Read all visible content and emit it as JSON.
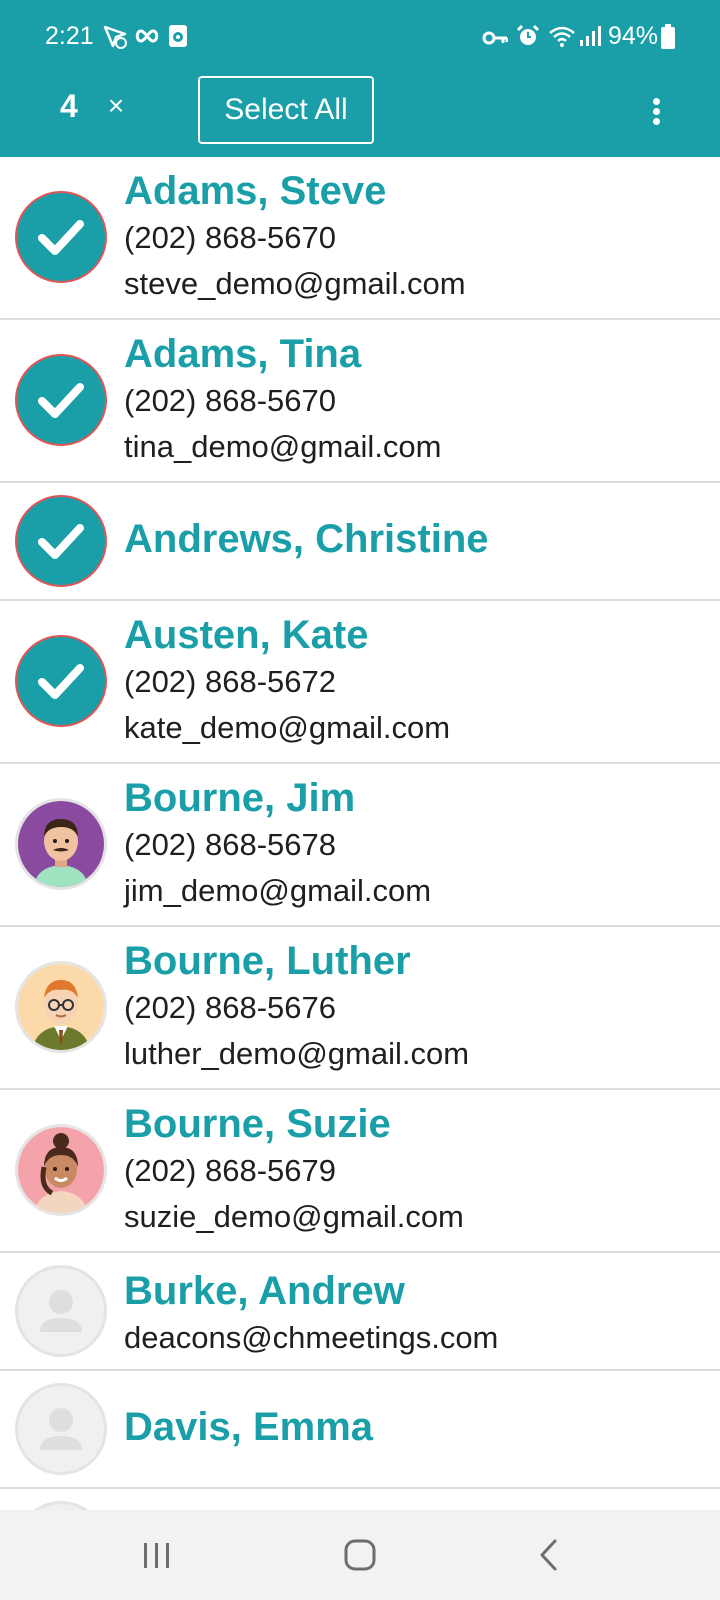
{
  "status_bar": {
    "time": "2:21",
    "battery": "94%",
    "left_icons": [
      "nav-arrow-icon",
      "infinity-icon",
      "app-badge-icon"
    ],
    "right_icons": [
      "key-icon",
      "alarm-icon",
      "wifi-icon",
      "signal-icon",
      "battery-icon"
    ]
  },
  "app_bar": {
    "selected_count": "4",
    "close_symbol": "×",
    "select_all_label": "Select All",
    "menu_icon": "more-vert-icon"
  },
  "colors": {
    "accent": "#1a9fa9",
    "check_border": "#e05656",
    "text": "#1f1f1f",
    "divider": "#dcdcdc"
  },
  "contacts": [
    {
      "name": "Adams, Steve",
      "phone": "(202) 868-5670",
      "email": "steve_demo@gmail.com",
      "selected": true,
      "avatar": "check-icon"
    },
    {
      "name": "Adams, Tina",
      "phone": "(202) 868-5670",
      "email": "tina_demo@gmail.com",
      "selected": true,
      "avatar": "check-icon"
    },
    {
      "name": "Andrews, Christine",
      "selected": true,
      "avatar": "check-icon"
    },
    {
      "name": "Austen, Kate",
      "phone": "(202) 868-5672",
      "email": "kate_demo@gmail.com",
      "selected": true,
      "avatar": "check-icon"
    },
    {
      "name": "Bourne, Jim",
      "phone": "(202) 868-5678",
      "email": "jim_demo@gmail.com",
      "selected": false,
      "avatar": "man-mustache-avatar"
    },
    {
      "name": "Bourne, Luther",
      "phone": "(202) 868-5676",
      "email": "luther_demo@gmail.com",
      "selected": false,
      "avatar": "man-glasses-avatar"
    },
    {
      "name": "Bourne, Suzie",
      "phone": "(202) 868-5679",
      "email": "suzie_demo@gmail.com",
      "selected": false,
      "avatar": "woman-avatar"
    },
    {
      "name": "Burke, Andrew",
      "email": "deacons@chmeetings.com",
      "selected": false,
      "avatar": "placeholder-avatar"
    },
    {
      "name": "Davis, Emma",
      "selected": false,
      "avatar": "placeholder-avatar"
    }
  ],
  "nav_bar": {
    "icons": [
      "recent-apps-icon",
      "home-icon",
      "back-icon"
    ]
  }
}
